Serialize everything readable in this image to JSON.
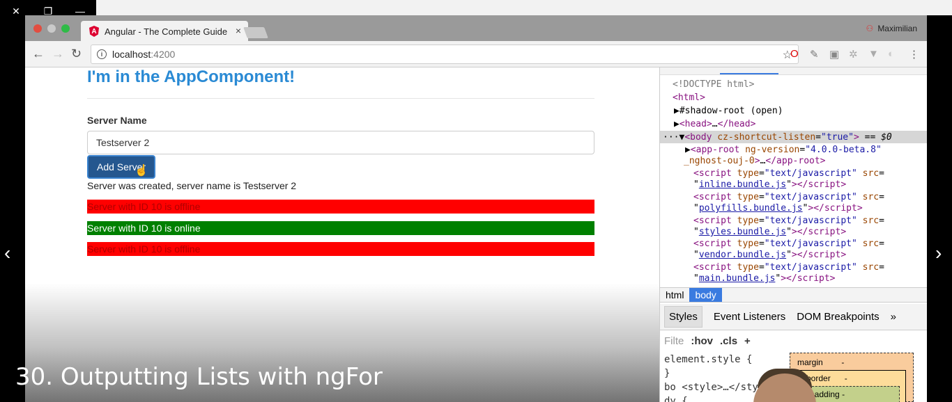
{
  "window": {
    "close_glyph": "✕",
    "restore_glyph": "❐",
    "minimize_glyph": "—"
  },
  "browser": {
    "tab_title": "Angular - The Complete Guide",
    "tab_close": "×",
    "user_name": "Maximilian",
    "url_host": "localhost",
    "url_port": ":4200"
  },
  "page": {
    "heading": "I'm in the AppComponent!",
    "server_name_label": "Server Name",
    "server_name_value": "Testserver 2",
    "add_server_button": "Add Server",
    "creation_message": "Server was created, server name is Testserver 2",
    "servers": [
      {
        "text": "Server with ID 10 is offline",
        "status": "offline"
      },
      {
        "text": "Server with ID 10 is online",
        "status": "online"
      },
      {
        "text": "Server with ID 10 is offline",
        "status": "offline"
      }
    ]
  },
  "devtools": {
    "breadcrumbs": [
      "html",
      "body"
    ],
    "panel_tabs": [
      "Styles",
      "Event Listeners",
      "DOM Breakpoints"
    ],
    "more_tabs": "»",
    "filter_placeholder": "Filte",
    "hov": ":hov",
    "cls": ".cls",
    "add": "+",
    "styles_lines": [
      "element.style {",
      "}",
      "bo <style>…</sty",
      "dy {"
    ],
    "box_margin": "margin",
    "box_border": "border",
    "box_padding": "padding",
    "box_dash": "-"
  },
  "caption": "30. Outputting Lists with ngFor",
  "colors": {
    "heading": "#2a8ad4",
    "offline": "#ff0000",
    "online": "#008000",
    "button": "#25578f"
  }
}
